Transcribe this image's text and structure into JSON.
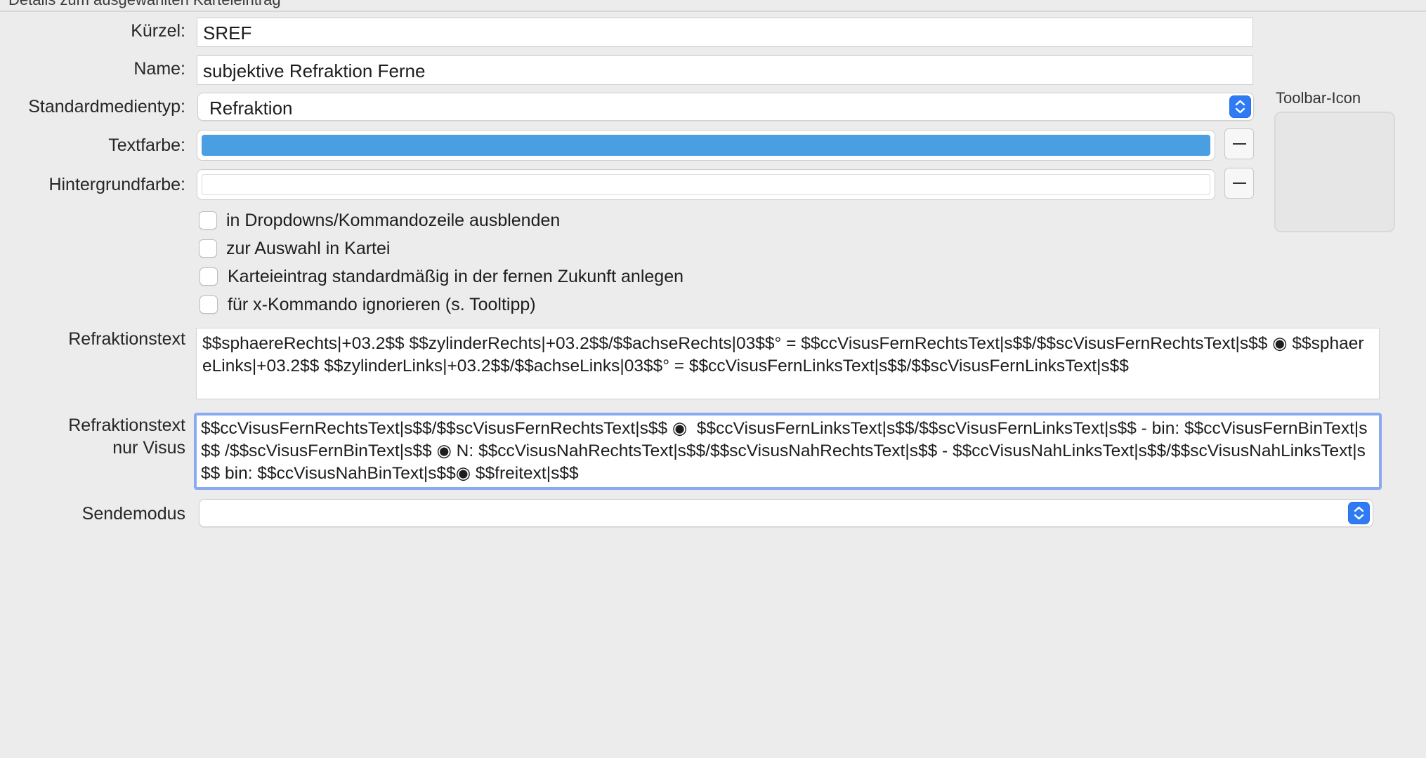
{
  "group": {
    "title": "Details zum ausgewählten Karteieintrag"
  },
  "labels": {
    "kuerzel": "Kürzel:",
    "name": "Name:",
    "standardmedientyp": "Standardmedientyp:",
    "textfarbe": "Textfarbe:",
    "hintergrundfarbe": "Hintergrundfarbe:",
    "refraktionstext": "Refraktionstext",
    "refraktionstext_visus_line1": "Refraktionstext",
    "refraktionstext_visus_line2": "nur Visus",
    "sendemodus": "Sendemodus"
  },
  "fields": {
    "kuerzel": "SREF",
    "name": "subjektive Refraktion Ferne",
    "standardmedientyp": "Refraktion",
    "sendemodus": ""
  },
  "colors": {
    "textfarbe": "#4a9fe3",
    "hintergrundfarbe": "#ffffff",
    "stepper": "#2f7bf5",
    "focus_ring": "#8aaaf0"
  },
  "checkboxes": [
    {
      "label": "in Dropdowns/Kommandozeile ausblenden",
      "checked": false
    },
    {
      "label": "zur Auswahl in Kartei",
      "checked": false
    },
    {
      "label": "Karteieintrag standardmäßig in der fernen Zukunft anlegen",
      "checked": false
    },
    {
      "label": "für x-Kommando ignorieren (s. Tooltipp)",
      "checked": false
    }
  ],
  "refraktionstext": "$$sphaereRechts|+03.2$$ $$zylinderRechts|+03.2$$/$$achseRechts|03$$° = $$ccVisusFernRechtsText|s$$/$$scVisusFernRechtsText|s$$ ◉ $$sphaereLinks|+03.2$$ $$zylinderLinks|+03.2$$/$$achseLinks|03$$° = $$ccVisusFernLinksText|s$$/$$scVisusFernLinksText|s$$",
  "refraktionstext_visus": "$$ccVisusFernRechtsText|s$$/$$scVisusFernRechtsText|s$$ ◉  $$ccVisusFernLinksText|s$$/$$scVisusFernLinksText|s$$ - bin: $$ccVisusFernBinText|s$$ /$$scVisusFernBinText|s$$ ◉ N: $$ccVisusNahRechtsText|s$$/$$scVisusNahRechtsText|s$$ - $$ccVisusNahLinksText|s$$/$$scVisusNahLinksText|s$$ bin: $$ccVisusNahBinText|s$$◉ $$freitext|s$$",
  "toolbar_icon": {
    "title": "Toolbar-Icon"
  }
}
